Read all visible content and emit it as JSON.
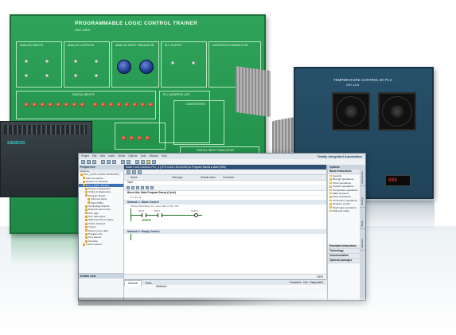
{
  "board": {
    "title": "PROGRAMMABLE LOGIC CONTROL TRAINER",
    "model": "DMT-1303",
    "sections": {
      "analog_inputs": "ANALOG INPUTS",
      "analog_outputs": "ANALOG OUTPUTS",
      "analog_sim": "ANALOG INPUT SIMULATOR",
      "plc_supply": "PLC SUPPLY",
      "interface": "INTERFACE CONNECTOR",
      "digital_inputs": "DIGITAL INPUTS",
      "plc_outputs": "PLC ADDRESS LIST",
      "converters": "CONVERTERS",
      "digital_sim": "DIGITAL INPUT SIMULATOR"
    }
  },
  "temperature_unit": {
    "title": "TEMPERATURE CONTROL BY PLC",
    "model": "DMT-1304",
    "display": "888"
  },
  "plc": {
    "logo": "SIEMENS"
  },
  "app": {
    "brand": "Totally Integrated Automation",
    "menu": [
      "Project",
      "Edit",
      "View",
      "Insert",
      "Online",
      "Options",
      "Tools",
      "Window",
      "Help"
    ],
    "tree_title": "Project tree",
    "tree_subtitle": "Devices",
    "tree_items": [
      "PLC_1 [CPU 1214C DC/DC/DC]",
      "Add new device",
      "Devices & networks",
      "PLC_1 [CPU 1214C]",
      "Device configuration",
      "Online & diagnostics",
      "Program blocks",
      "Add new block",
      "Main [OB1]",
      "Technology objects",
      "External source files",
      "PLC tags",
      "PLC data types",
      "Watch and force tables",
      "Online backups",
      "Traces",
      "Device proxy data",
      "Program info",
      "PLC alarms",
      "Text lists",
      "Local modules"
    ],
    "details_title": "Details view",
    "breadcrumb": "Motor Level Control ▸ PLC_1 [CPU 1214C DC/DC/DC] ▸ Program blocks ▸ Main [OB1]",
    "interface_header": {
      "name": "Name",
      "datatype": "Data type",
      "default": "Default value",
      "comment": "Comment"
    },
    "interface_row": "Input",
    "block_title": "Block title: Main Program Sweep (Cycle)",
    "block_comment": "Comment",
    "network1": {
      "title": "Network 1: Motor Control",
      "comment": "Simple Start/Stop of a motor with 2 N/O, N/C",
      "op1": "%I0.0",
      "op2": "%I0.1",
      "op3": "%Q0.0"
    },
    "network2": {
      "title": "Network 2: Empty Control"
    },
    "zoom": "100%",
    "inspector_tabs": [
      "General",
      "Texts"
    ],
    "inspector_right": "Properties",
    "inspector_info": "Info",
    "inspector_diag": "Diagnostics",
    "inspector_row": "Attributes",
    "tasks_title": "Options",
    "tasks_sections": [
      "Basic instructions",
      "Extended instructions",
      "Technology",
      "Communication",
      "Optional packages"
    ],
    "instruction_items": [
      "General",
      "Bit logic operations",
      "Timer operations",
      "Counter operations",
      "Comparator operations",
      "Math functions",
      "Move operations",
      "Conversion operations",
      "Program control",
      "Word logic operations",
      "Shift and rotate"
    ],
    "side_tabs": [
      "Instructions",
      "Testing",
      "Tasks",
      "Libraries"
    ],
    "taskbar_items": [
      "Overview",
      "Main (OB1)"
    ]
  }
}
